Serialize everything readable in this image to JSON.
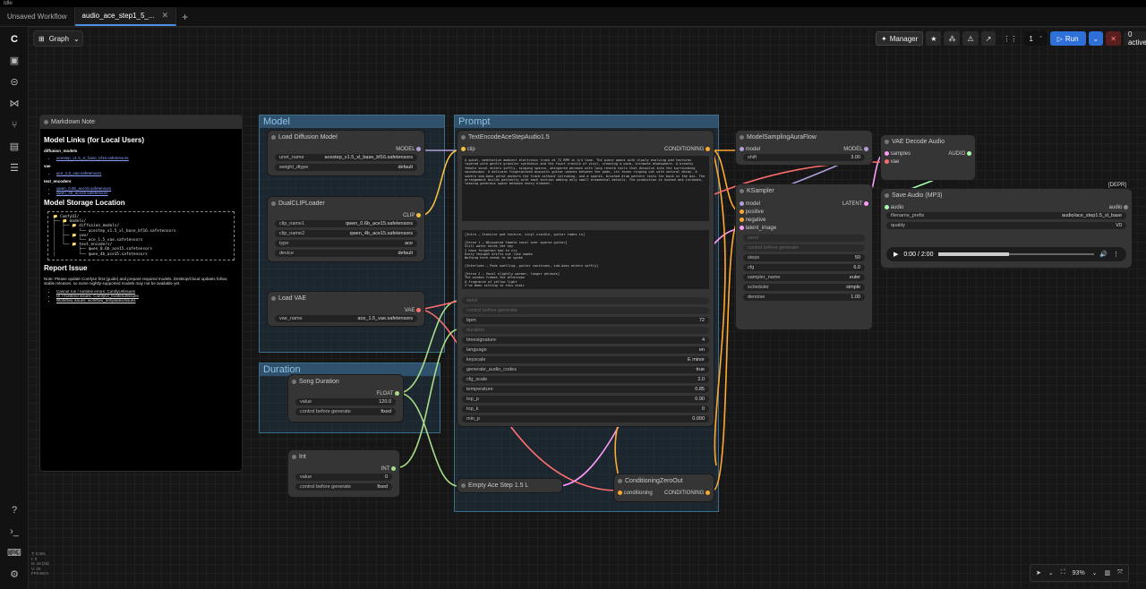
{
  "titlebar": "Idle",
  "tabs": [
    {
      "label": "Unsaved Workflow"
    },
    {
      "label": "audio_ace_step1_5_..."
    }
  ],
  "graph_button": "Graph",
  "topbar": {
    "manager": "Manager",
    "queue_count": "1",
    "run": "Run",
    "active": "0 active"
  },
  "groups": {
    "model": "Model",
    "prompt": "Prompt",
    "duration": "Duration"
  },
  "markdown": {
    "title": "Markdown Note",
    "h1_links": "Model Links (for Local Users)",
    "diffusion_heading": "diffusion_models",
    "diffusion_link": "acestep_v1.5_xl_base_bf16.safetensors",
    "vae_heading": "vae",
    "vae_link": "ace_1.5_vae.safetensors",
    "text_encoders_heading": "text_encoders",
    "te_link1": "qwen_0.6b_ace15.safetensors",
    "te_link2": "qwen_4b_ace15.safetensors",
    "h1_storage": "Model Storage Location",
    "tree": "📁 ComfyUI/\n├── 📁 models/\n│   ├── 📁 diffusion_models/\n│   │      └── acestep_v1.5_xl_base_bf16.safetensors\n│   ├── 📁 vae/\n│   │      └── ace_1.5_vae.safetensors\n│   └── 📁 text_encoders/\n│          ├── qwen_0.6b_ace15.safetensors\n│          └── qwen_4b_ace15.safetensors",
    "h1_report": "Report Issue",
    "note": "Note: Please update ComfyUI first (guide) and prepare required models. Desktop/Cloud updates follow stable releases, so some nightly-supported models may not be available yet.",
    "issue1": "Cannot run / runtime errors: ComfyUI/issues",
    "issue2": "UI / frontend issues: ComfyUI_frontend/issues",
    "issue3": "Workflow issues: workflow_templates/issues"
  },
  "nodes": {
    "load_diffusion": {
      "title": "Load Diffusion Model",
      "out": "MODEL",
      "unet_name_label": "unet_name",
      "unet_name": "acestep_v1.5_xl_base_bf16.safetensors",
      "weight_dtype_label": "weight_dtype",
      "weight_dtype": "default"
    },
    "dualclip": {
      "title": "DualCLIPLoader",
      "out": "CLIP",
      "clip1_label": "clip_name1",
      "clip1": "qwen_0.6b_ace15.safetensors",
      "clip2_label": "clip_name2",
      "clip2": "qwen_4b_ace15.safetensors",
      "type_label": "type",
      "type": "ace",
      "device_label": "device",
      "device": "default"
    },
    "load_vae": {
      "title": "Load VAE",
      "out": "VAE",
      "vae_label": "vae_name",
      "vae": "ace_1.5_vae.safetensors"
    },
    "song_duration": {
      "title": "Song Duration",
      "out": "FLOAT",
      "value_label": "value",
      "value": "120.0",
      "cbg_label": "control before generate",
      "cbg": "fixed"
    },
    "int": {
      "title": "Int",
      "out": "INT",
      "value_label": "value",
      "value": "0",
      "cbg_label": "control before generate",
      "cbg": "fixed"
    },
    "text_encode": {
      "title": "TextEncodeAceStepAudio1.5",
      "in": "clip",
      "out": "CONDITIONING",
      "tags": "A quiet, meditative ambient electronic track at 72 BPM in 4/4 time. The piece opens with slowly evolving pad textures layered with gentle granular synthesis and the faint crackle of vinyl, creating a warm, intimate atmosphere. A breathy female vocal enters softly, singing sparse, whispered phrases with long reverb tails that dissolve into the surrounding soundscape. A delicate fingerpicked acoustic guitar weaves between the pads, its tones ringing out with natural decay. A subtle sub-bass pulse anchors the track without intruding, and a sparse, brushed drum pattern rests far back in the mix. The arrangement builds patiently with each section adding only small ornamental details. The production is hushed and intimate, leaving generous space between every element.",
      "lyrics": "[Intro – Granular pad texture, vinyl crackle, guitar fades in]\n\n[Verse 1 – Whispered female vocal over sparse guitar]\nStill water holds the sky\nI have forgotten how to cry\nEvery thought drifts out like smoke\nNothing here needs to be spoke\n\n[Interlude – Pads swelling, guitar continues, sub-bass enters softly]\n\n[Verse 2 – Vocal slightly warmer, longer phrases]\nThe window frames the afternoon\nA fragrance of yellow light\nI've been sitting in this chair",
      "seed_label": "seed",
      "cbg_label": "control before generate",
      "bpm_label": "bpm",
      "bpm": "72",
      "duration_label": "duration",
      "timesig_label": "timesignature",
      "timesig": "4",
      "language_label": "language",
      "language": "en",
      "keyscale_label": "keyscale",
      "keyscale": "E minor",
      "gen_audio_codes_label": "generate_audio_codes",
      "gen_audio_codes": "true",
      "cfg_scale_label": "cfg_scale",
      "cfg_scale": "2.0",
      "temperature_label": "temperature",
      "temperature": "0.85",
      "top_p_label": "top_p",
      "top_p": "0.90",
      "top_k_label": "top_k",
      "top_k": "0",
      "min_p_label": "min_p",
      "min_p": "0.000"
    },
    "empty_ace": {
      "title": "Empty Ace Step 1.5 L"
    },
    "cond_zero": {
      "title": "ConditioningZeroOut",
      "in": "conditioning",
      "out": "CONDITIONING"
    },
    "model_sampling": {
      "title": "ModelSamplingAuraFlow",
      "in": "model",
      "out": "MODEL",
      "shift_label": "shift",
      "shift": "3.00"
    },
    "ksampler": {
      "title": "KSampler",
      "in_model": "model",
      "in_positive": "positive",
      "in_negative": "negative",
      "in_latent": "latent_image",
      "out": "LATENT",
      "seed_label": "seed",
      "cbg_label": "control before generate",
      "steps_label": "steps",
      "steps": "50",
      "cfg_label": "cfg",
      "cfg": "6.0",
      "sampler_label": "sampler_name",
      "sampler": "euler",
      "scheduler_label": "scheduler",
      "scheduler": "simple",
      "denoise_label": "denoise",
      "denoise": "1.00"
    },
    "vae_decode": {
      "title": "VAE Decode Audio",
      "in_samples": "samples",
      "in_vae": "vae",
      "out": "AUDIO"
    },
    "save_audio": {
      "title": "Save Audio (MP3)",
      "badge": "[DEPR]",
      "in": "audio",
      "out": "audio",
      "prefix_label": "filename_prefix",
      "prefix": "audio/ace_step1.5_xl_base",
      "quality_label": "quality",
      "quality": "V0",
      "time": "0:00 / 2:00"
    }
  },
  "stats": "T: 0.00s\nI: 0\nN: 16 [16]\nV: 30\nFPS:60.0",
  "zoom": "93%",
  "colors": {
    "model": "#b39ddb",
    "clip": "#f4c042",
    "vae": "#ff6e6e",
    "conditioning": "#ffa931",
    "latent": "#ff9cf9",
    "float_int": "#aadd88",
    "audio": "#aaffaa"
  }
}
